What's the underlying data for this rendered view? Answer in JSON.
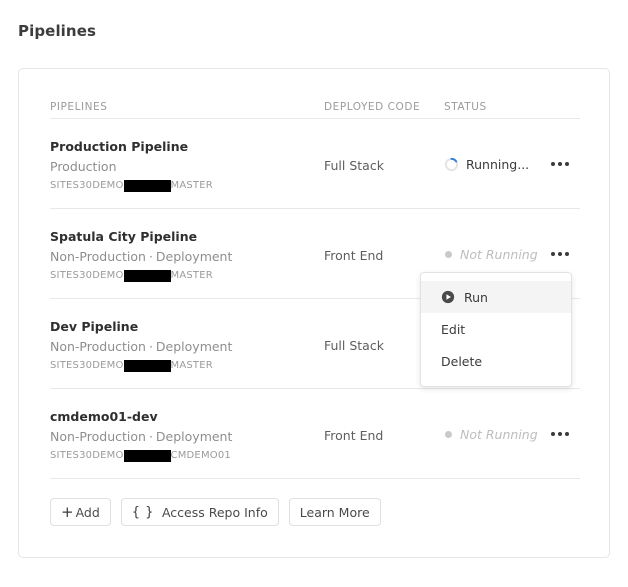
{
  "page": {
    "title": "Pipelines"
  },
  "table": {
    "headers": {
      "pipelines": "PIPELINES",
      "deployed_code": "DEPLOYED CODE",
      "status": "STATUS"
    },
    "rows": [
      {
        "name": "Production Pipeline",
        "environment": "Production",
        "type": "",
        "separator": "",
        "repo_prefix": "SITES30DEMO",
        "repo_redacted": true,
        "repo_branch": "MASTER",
        "deployed_code": "Full Stack",
        "status_label": "Running...",
        "status_state": "running",
        "menu_icon": "ellipsis-icon"
      },
      {
        "name": "Spatula City Pipeline",
        "environment": "Non-Production",
        "type": "Deployment",
        "separator": "·",
        "repo_prefix": "SITES30DEMO",
        "repo_redacted": true,
        "repo_branch": "MASTER",
        "deployed_code": "Front End",
        "status_label": "Not Running",
        "status_state": "idle",
        "menu_icon": "ellipsis-icon"
      },
      {
        "name": "Dev Pipeline",
        "environment": "Non-Production",
        "type": "Deployment",
        "separator": "·",
        "repo_prefix": "SITES30DEMO",
        "repo_redacted": true,
        "repo_branch": "MASTER",
        "deployed_code": "Full Stack",
        "status_label": "",
        "status_state": "hidden",
        "menu_icon": "ellipsis-icon"
      },
      {
        "name": "cmdemo01-dev",
        "environment": "Non-Production",
        "type": "Deployment",
        "separator": "·",
        "repo_prefix": "SITES30DEMO",
        "repo_redacted": true,
        "repo_branch": "CMDEMO01",
        "deployed_code": "Front End",
        "status_label": "Not Running",
        "status_state": "idle",
        "menu_icon": "ellipsis-icon"
      }
    ]
  },
  "footer": {
    "add_label": "Add",
    "add_icon": "plus-icon",
    "access_repo_label": "Access Repo Info",
    "access_repo_icon": "curly-braces-icon",
    "learn_more_label": "Learn More"
  },
  "dropdown": {
    "open_for_row": "Spatula City Pipeline",
    "items": [
      {
        "label": "Run",
        "icon": "play-circle-icon",
        "highlighted": true
      },
      {
        "label": "Edit",
        "icon": "",
        "highlighted": false
      },
      {
        "label": "Delete",
        "icon": "",
        "highlighted": false
      }
    ]
  },
  "colors": {
    "accent_spinner": "#2f7fe0",
    "status_idle_text": "#bdbdbd",
    "status_idle_dot": "#c9c9c9",
    "card_border": "#e6e6e6",
    "divider": "#e8e8e8",
    "redaction": "#000000",
    "menu_highlight": "#f4f4f4"
  }
}
